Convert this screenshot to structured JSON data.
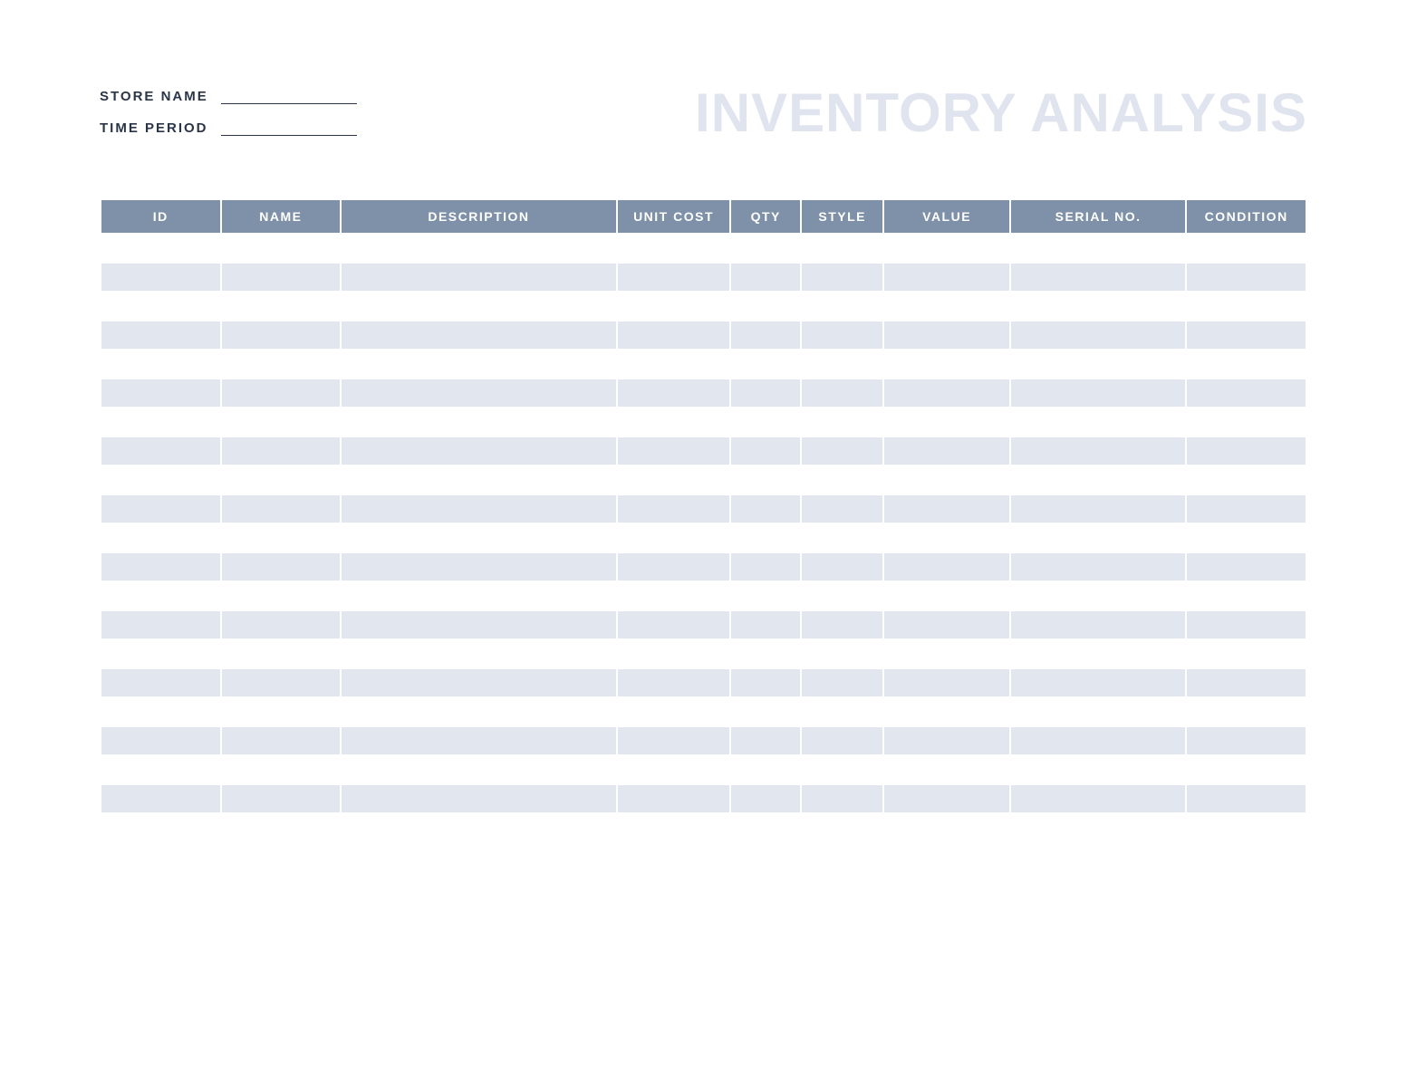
{
  "title": "INVENTORY ANALYSIS",
  "meta": {
    "store_name_label": "STORE NAME",
    "store_name_value": "",
    "time_period_label": "TIME PERIOD",
    "time_period_value": ""
  },
  "table": {
    "headers": {
      "id": "ID",
      "name": "NAME",
      "description": "DESCRIPTION",
      "unit_cost": "UNIT COST",
      "qty": "QTY",
      "style": "STYLE",
      "value": "VALUE",
      "serial_no": "SERIAL NO.",
      "condition": "CONDITION"
    },
    "rows": [
      {
        "id": "",
        "name": "",
        "description": "",
        "unit_cost": "",
        "qty": "",
        "style": "",
        "value": "",
        "serial_no": "",
        "condition": ""
      },
      {
        "id": "",
        "name": "",
        "description": "",
        "unit_cost": "",
        "qty": "",
        "style": "",
        "value": "",
        "serial_no": "",
        "condition": ""
      },
      {
        "id": "",
        "name": "",
        "description": "",
        "unit_cost": "",
        "qty": "",
        "style": "",
        "value": "",
        "serial_no": "",
        "condition": ""
      },
      {
        "id": "",
        "name": "",
        "description": "",
        "unit_cost": "",
        "qty": "",
        "style": "",
        "value": "",
        "serial_no": "",
        "condition": ""
      },
      {
        "id": "",
        "name": "",
        "description": "",
        "unit_cost": "",
        "qty": "",
        "style": "",
        "value": "",
        "serial_no": "",
        "condition": ""
      },
      {
        "id": "",
        "name": "",
        "description": "",
        "unit_cost": "",
        "qty": "",
        "style": "",
        "value": "",
        "serial_no": "",
        "condition": ""
      },
      {
        "id": "",
        "name": "",
        "description": "",
        "unit_cost": "",
        "qty": "",
        "style": "",
        "value": "",
        "serial_no": "",
        "condition": ""
      },
      {
        "id": "",
        "name": "",
        "description": "",
        "unit_cost": "",
        "qty": "",
        "style": "",
        "value": "",
        "serial_no": "",
        "condition": ""
      },
      {
        "id": "",
        "name": "",
        "description": "",
        "unit_cost": "",
        "qty": "",
        "style": "",
        "value": "",
        "serial_no": "",
        "condition": ""
      },
      {
        "id": "",
        "name": "",
        "description": "",
        "unit_cost": "",
        "qty": "",
        "style": "",
        "value": "",
        "serial_no": "",
        "condition": ""
      },
      {
        "id": "",
        "name": "",
        "description": "",
        "unit_cost": "",
        "qty": "",
        "style": "",
        "value": "",
        "serial_no": "",
        "condition": ""
      },
      {
        "id": "",
        "name": "",
        "description": "",
        "unit_cost": "",
        "qty": "",
        "style": "",
        "value": "",
        "serial_no": "",
        "condition": ""
      },
      {
        "id": "",
        "name": "",
        "description": "",
        "unit_cost": "",
        "qty": "",
        "style": "",
        "value": "",
        "serial_no": "",
        "condition": ""
      },
      {
        "id": "",
        "name": "",
        "description": "",
        "unit_cost": "",
        "qty": "",
        "style": "",
        "value": "",
        "serial_no": "",
        "condition": ""
      },
      {
        "id": "",
        "name": "",
        "description": "",
        "unit_cost": "",
        "qty": "",
        "style": "",
        "value": "",
        "serial_no": "",
        "condition": ""
      },
      {
        "id": "",
        "name": "",
        "description": "",
        "unit_cost": "",
        "qty": "",
        "style": "",
        "value": "",
        "serial_no": "",
        "condition": ""
      },
      {
        "id": "",
        "name": "",
        "description": "",
        "unit_cost": "",
        "qty": "",
        "style": "",
        "value": "",
        "serial_no": "",
        "condition": ""
      },
      {
        "id": "",
        "name": "",
        "description": "",
        "unit_cost": "",
        "qty": "",
        "style": "",
        "value": "",
        "serial_no": "",
        "condition": ""
      },
      {
        "id": "",
        "name": "",
        "description": "",
        "unit_cost": "",
        "qty": "",
        "style": "",
        "value": "",
        "serial_no": "",
        "condition": ""
      },
      {
        "id": "",
        "name": "",
        "description": "",
        "unit_cost": "",
        "qty": "",
        "style": "",
        "value": "",
        "serial_no": "",
        "condition": ""
      },
      {
        "id": "",
        "name": "",
        "description": "",
        "unit_cost": "",
        "qty": "",
        "style": "",
        "value": "",
        "serial_no": "",
        "condition": ""
      }
    ]
  }
}
